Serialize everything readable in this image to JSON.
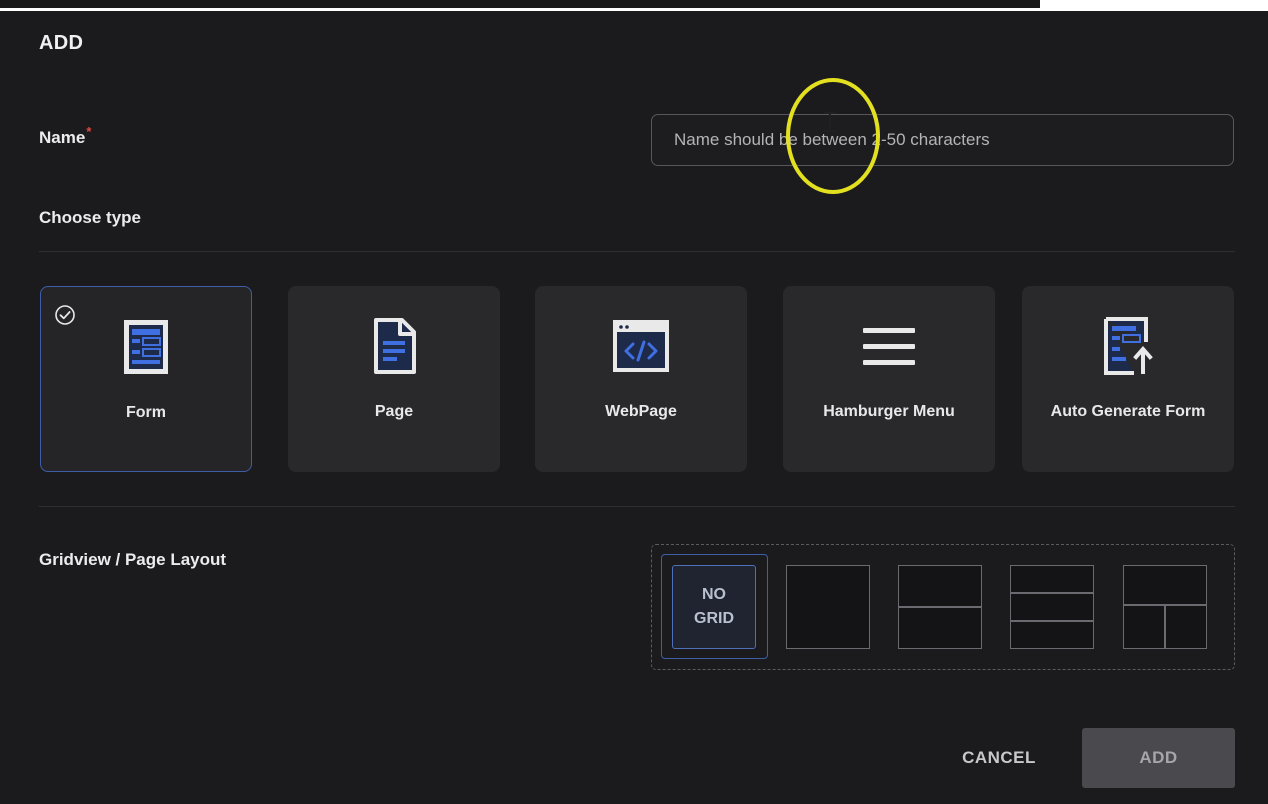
{
  "dialog": {
    "title": "ADD"
  },
  "name_field": {
    "label": "Name",
    "required_marker": "*",
    "placeholder": "Name should be between 2-50 characters",
    "value": ""
  },
  "type_section": {
    "label": "Choose type",
    "selected": "Form",
    "options": [
      {
        "label": "Form",
        "icon": "form-icon",
        "selected": true
      },
      {
        "label": "Page",
        "icon": "page-icon",
        "selected": false
      },
      {
        "label": "WebPage",
        "icon": "webpage-icon",
        "selected": false
      },
      {
        "label": "Hamburger Menu",
        "icon": "hamburger-menu-icon",
        "selected": false
      },
      {
        "label": "Auto Generate Form",
        "icon": "auto-generate-form-icon",
        "selected": false
      }
    ]
  },
  "layout_section": {
    "label": "Gridview / Page Layout",
    "selected": "no-grid",
    "options": [
      {
        "id": "no-grid",
        "label_line1": "NO",
        "label_line2": "GRID"
      },
      {
        "id": "single-panel"
      },
      {
        "id": "two-rows"
      },
      {
        "id": "three-rows"
      },
      {
        "id": "row-and-two-columns"
      }
    ]
  },
  "actions": {
    "cancel_label": "CANCEL",
    "add_label": "ADD"
  },
  "colors": {
    "background": "#1b1b1e",
    "card": "#29292c",
    "accent_blue": "#3e5fa8",
    "icon_blue": "#3f6fe0",
    "required": "#e0493e",
    "cursor_highlight": "#e3e020"
  }
}
